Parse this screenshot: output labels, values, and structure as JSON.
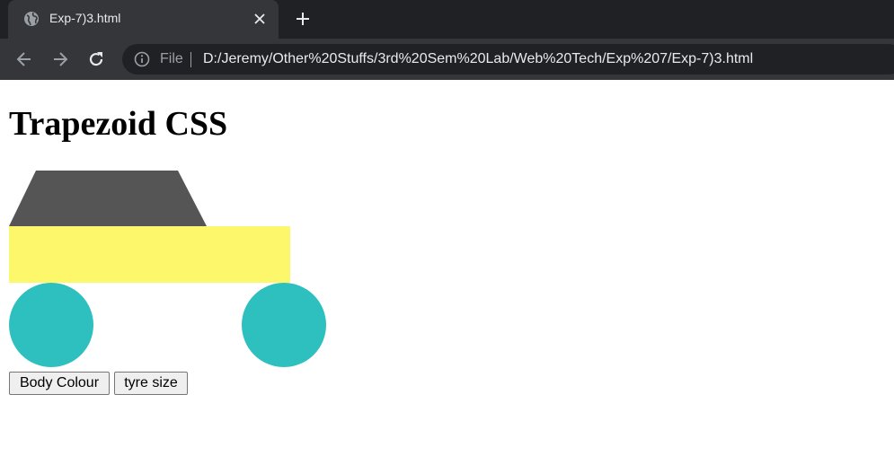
{
  "browser": {
    "tab": {
      "title": "Exp-7)3.html",
      "favicon": "globe-icon"
    },
    "address_bar": {
      "scheme_label": "File",
      "url": "D:/Jeremy/Other%20Stuffs/3rd%20Sem%20Lab/Web%20Tech/Exp%207/Exp-7)3.html"
    }
  },
  "page": {
    "heading": "Trapezoid CSS",
    "car": {
      "roof_color": "#555555",
      "body_color": "#fdf76b",
      "tyre_color": "#2ebfbf"
    },
    "buttons": {
      "body_colour": "Body Colour",
      "tyre_size": "tyre size"
    }
  }
}
